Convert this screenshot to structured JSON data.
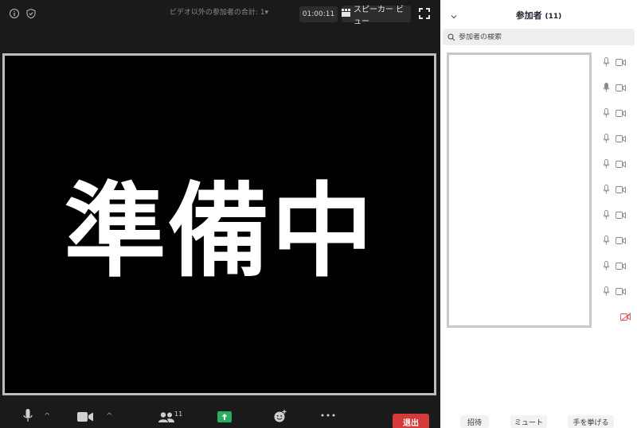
{
  "meeting": {
    "participant_count_label": "ビデオ以外の参加者の合計: 1",
    "timer": "01:00:11",
    "speaker_view_label": "スピーカー ビュー",
    "video_text": "準備中"
  },
  "toolbar": {
    "participants_count": "11",
    "leave_label": "退出"
  },
  "panel": {
    "title": "参加者",
    "count": "(11)",
    "search_placeholder": "参加者の検索",
    "buttons": [
      "招待",
      "ミュート",
      "手を挙げる"
    ]
  },
  "colors": {
    "leave": "#d43a3a",
    "share": "#27ae60",
    "video_off": "#e05252"
  }
}
